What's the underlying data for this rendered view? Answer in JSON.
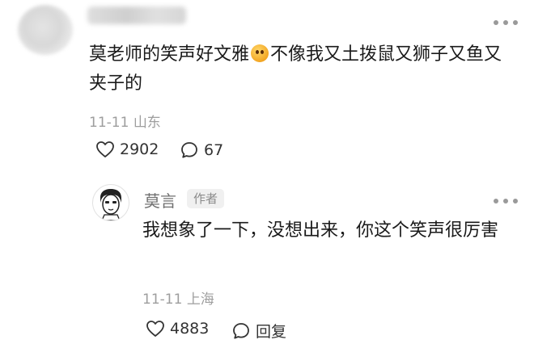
{
  "comment": {
    "text_part1": "莫老师的笑声好文雅",
    "text_part2": "不像我又土拨鼠又狮子又鱼又夹子的",
    "date": "11-11",
    "location": "山东",
    "likes": "2902",
    "replies": "67"
  },
  "reply": {
    "author": "莫言",
    "badge": "作者",
    "text": "我想象了一下，没想出来，你这个笑声很厉害",
    "date": "11-11",
    "location": "上海",
    "likes": "4883",
    "reply_label": "回复"
  },
  "icons": {
    "more": "more-horizontal-icon",
    "like": "heart-outline-icon",
    "reply": "speech-bubble-icon",
    "emoji": "grinning-face-emoji"
  }
}
